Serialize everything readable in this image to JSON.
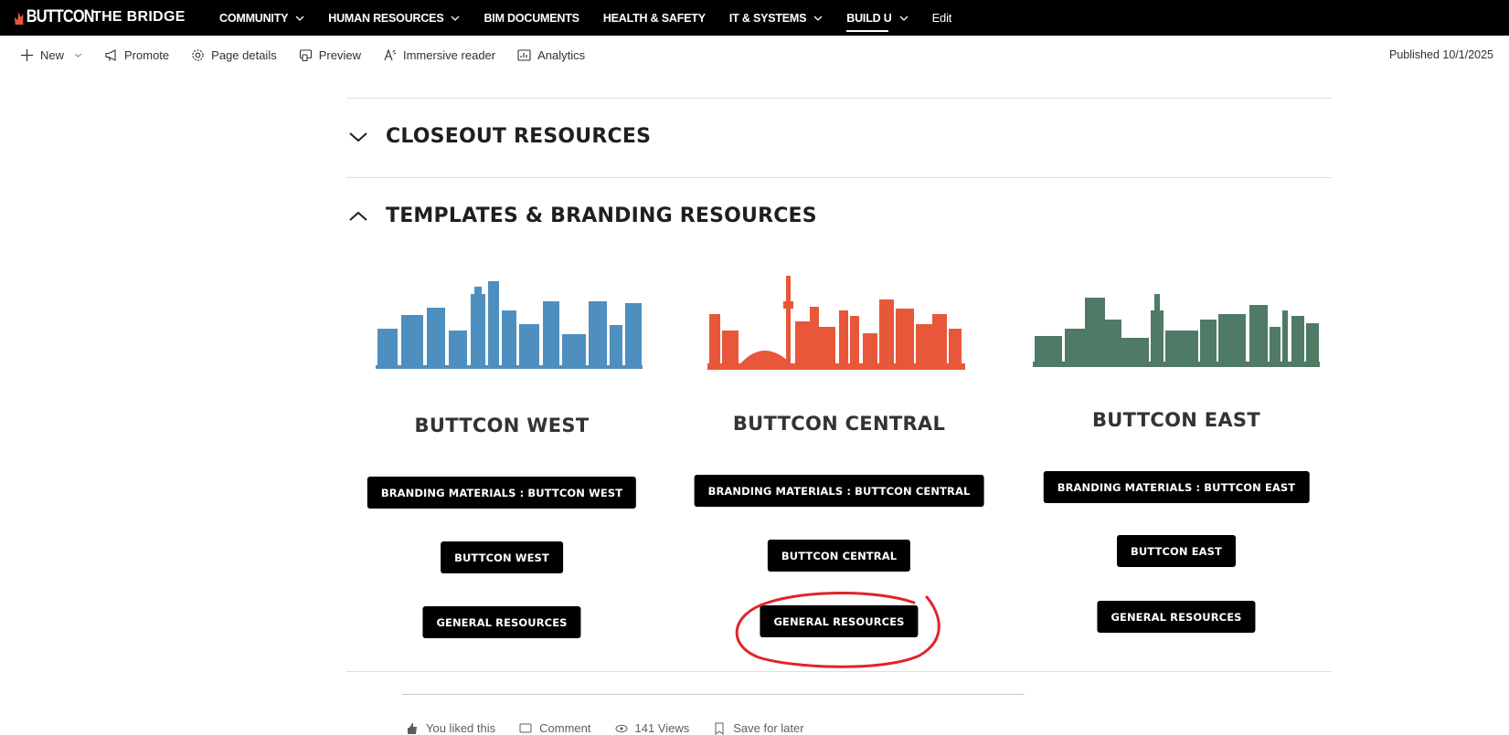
{
  "topnav": {
    "logo_text": "BUTTCON",
    "site_title": "THE BRIDGE",
    "items": [
      {
        "label": "COMMUNITY",
        "has_dropdown": true,
        "active": false
      },
      {
        "label": "HUMAN RESOURCES",
        "has_dropdown": true,
        "active": false
      },
      {
        "label": "BIM DOCUMENTS",
        "has_dropdown": false,
        "active": false
      },
      {
        "label": "HEALTH & SAFETY",
        "has_dropdown": false,
        "active": false
      },
      {
        "label": "IT & SYSTEMS",
        "has_dropdown": true,
        "active": false
      },
      {
        "label": "BUILD U",
        "has_dropdown": true,
        "active": true
      },
      {
        "label": "Edit",
        "has_dropdown": false,
        "active": false
      }
    ]
  },
  "cmdbar": {
    "new_label": "New",
    "promote_label": "Promote",
    "page_details_label": "Page details",
    "preview_label": "Preview",
    "immersive_label": "Immersive reader",
    "analytics_label": "Analytics",
    "published": "Published 10/1/2025"
  },
  "sections": {
    "closeout": {
      "title": "CLOSEOUT RESOURCES",
      "expanded": false
    },
    "templates": {
      "title": "TEMPLATES & BRANDING RESOURCES",
      "expanded": true
    }
  },
  "regions": {
    "west": {
      "color": "#4f8fc0",
      "title": "BUTTCON WEST",
      "buttons": [
        "BRANDING MATERIALS : BUTTCON WEST",
        "BUTTCON WEST",
        "GENERAL RESOURCES"
      ]
    },
    "central": {
      "color": "#e8573a",
      "title": "BUTTCON CENTRAL",
      "buttons": [
        "BRANDING MATERIALS : BUTTCON CENTRAL",
        "BUTTCON CENTRAL",
        "GENERAL RESOURCES"
      ]
    },
    "east": {
      "color": "#4f7a66",
      "title": "BUTTCON EAST",
      "buttons": [
        "BRANDING MATERIALS : BUTTCON EAST",
        "BUTTCON EAST",
        "GENERAL RESOURCES"
      ]
    }
  },
  "annotation_color": "#e0242a",
  "footer": {
    "like": "You liked this",
    "comment": "Comment",
    "views": "141 Views",
    "save": "Save for later"
  }
}
